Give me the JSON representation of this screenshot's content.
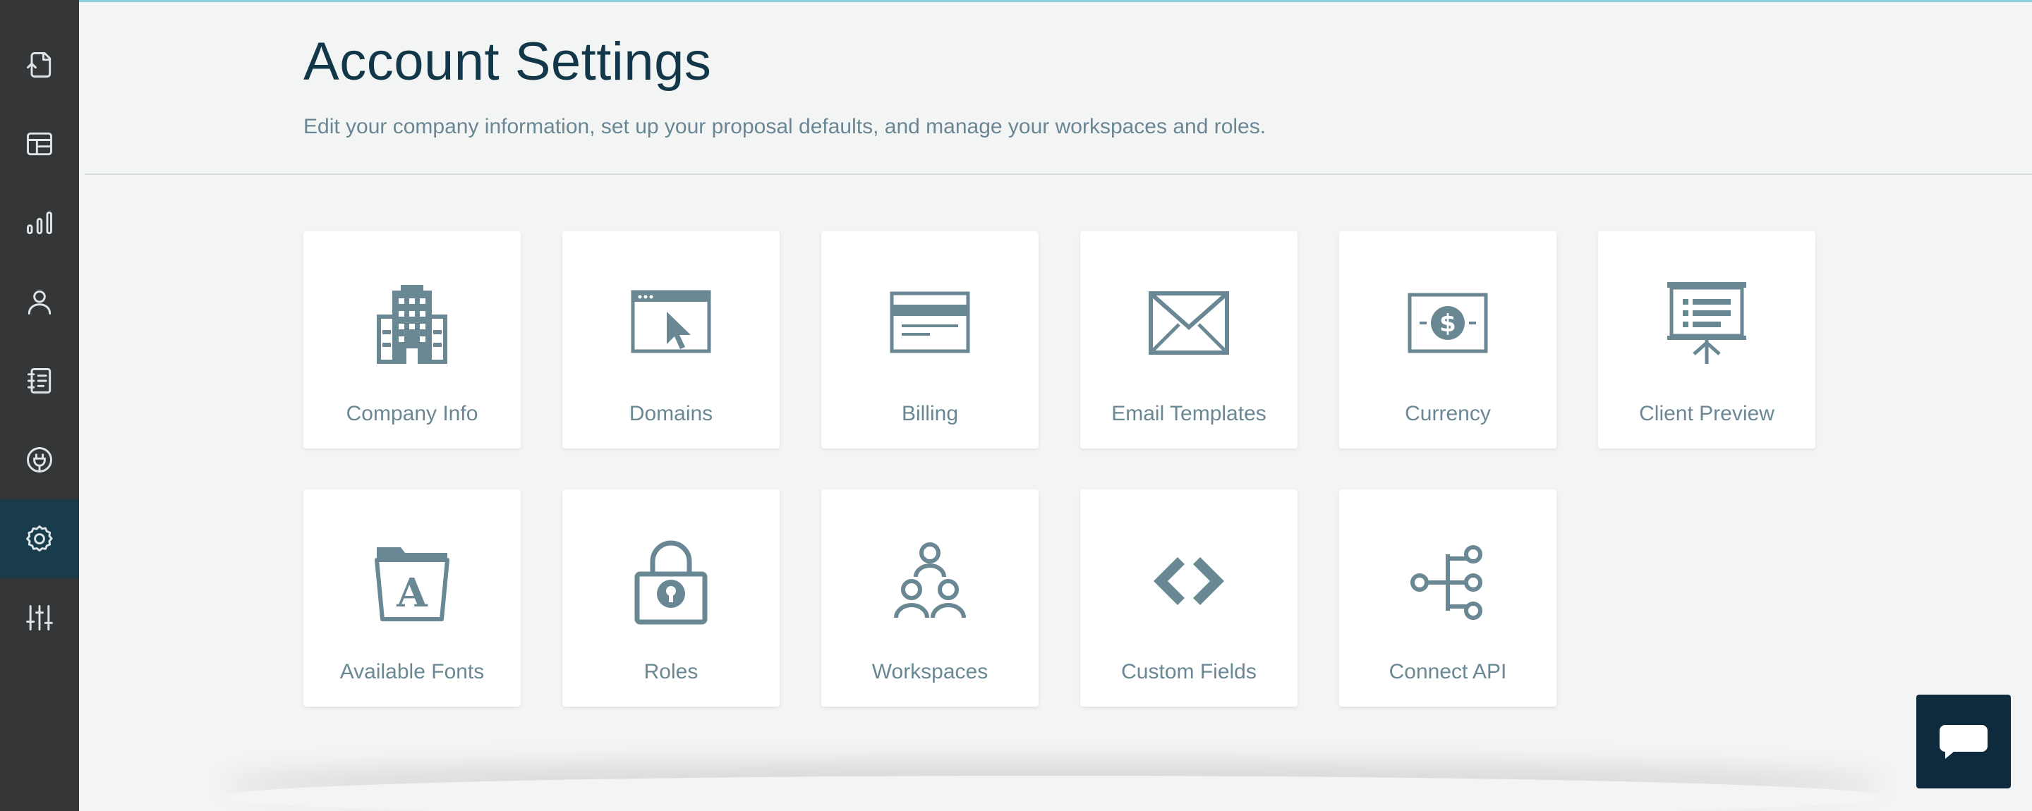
{
  "header": {
    "title": "Account Settings",
    "subtitle": "Edit your company information, set up your proposal defaults, and manage your workspaces and roles."
  },
  "sidebar": {
    "items": [
      {
        "icon": "document-icon",
        "active": false
      },
      {
        "icon": "layout-icon",
        "active": false
      },
      {
        "icon": "bar-chart-icon",
        "active": false
      },
      {
        "icon": "user-icon",
        "active": false
      },
      {
        "icon": "notebook-icon",
        "active": false
      },
      {
        "icon": "plug-icon",
        "active": false
      },
      {
        "icon": "gear-icon",
        "active": true
      },
      {
        "icon": "sliders-icon",
        "active": false
      }
    ]
  },
  "cards": [
    {
      "label": "Company Info",
      "icon": "building-icon"
    },
    {
      "label": "Domains",
      "icon": "browser-cursor-icon"
    },
    {
      "label": "Billing",
      "icon": "credit-card-icon"
    },
    {
      "label": "Email Templates",
      "icon": "envelope-icon"
    },
    {
      "label": "Currency",
      "icon": "dollar-bill-icon"
    },
    {
      "label": "Client Preview",
      "icon": "presentation-board-icon"
    },
    {
      "label": "Available Fonts",
      "icon": "font-folder-icon"
    },
    {
      "label": "Roles",
      "icon": "padlock-icon"
    },
    {
      "label": "Workspaces",
      "icon": "people-group-icon"
    },
    {
      "label": "Custom Fields",
      "icon": "code-brackets-icon"
    },
    {
      "label": "Connect API",
      "icon": "api-network-icon"
    }
  ],
  "colors": {
    "sidebar_bg": "#343637",
    "sidebar_active": "#193c4d",
    "title": "#123749",
    "icon": "#6a8794",
    "chat_bg": "#0e2a3d"
  },
  "chat": {
    "icon": "chat-bubble-icon"
  }
}
